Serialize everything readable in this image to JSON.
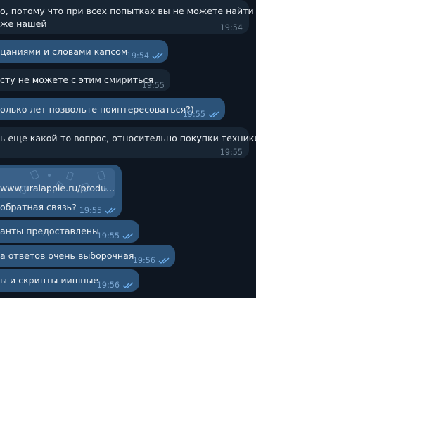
{
  "messages": [
    {
      "text1": "о, потому что при всех попытках вы не можете найти",
      "text2": "же нашей",
      "time": "19:54"
    },
    {
      "text": "цаниями и словами капсом",
      "time": "19:54"
    },
    {
      "text": "сту не можете с этим смириться",
      "time": "19:55"
    },
    {
      "text": "олько лет позвольте поинтересоваться?)",
      "time": "19:55"
    },
    {
      "text": "ь еще какой-то вопрос, относительно покупки техники?",
      "time": "19:55"
    },
    {
      "link": "www.uralapple.ru/produ...",
      "text": "обратная связь?",
      "time": "19:55"
    },
    {
      "text": "анты предоставлены",
      "time": "19:55"
    },
    {
      "text": "а ответов очень выборочная",
      "time": "19:56"
    },
    {
      "text": "ы и скрипты иишные",
      "time": "19:56"
    }
  ],
  "colors": {
    "chat_bg": "#0e1621",
    "incoming_bubble": "#182533",
    "outgoing_bubble": "#2b5278",
    "check_marks": "#6fb1f0"
  }
}
